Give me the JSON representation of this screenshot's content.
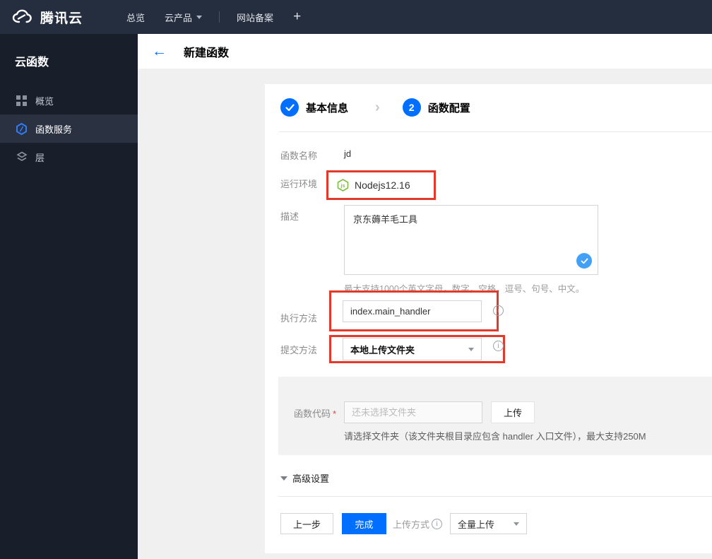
{
  "topbar": {
    "brand": "腾讯云",
    "nav": [
      {
        "label": "总览"
      },
      {
        "label": "云产品"
      },
      {
        "label": "网站备案"
      },
      {
        "label": "+"
      }
    ]
  },
  "sidebar": {
    "title": "云函数",
    "items": [
      {
        "label": "概览",
        "active": false
      },
      {
        "label": "函数服务",
        "active": true
      },
      {
        "label": "层",
        "active": false
      }
    ]
  },
  "header": {
    "title": "新建函数"
  },
  "steps": {
    "step1_label": "基本信息",
    "step2_number": "2",
    "step2_label": "函数配置"
  },
  "form": {
    "name_label": "函数名称",
    "name_value": "jd",
    "runtime_label": "运行环境",
    "runtime_value": "Nodejs12.16",
    "runtime_icon_text": "js",
    "desc_label": "描述",
    "desc_value": "京东薅羊毛工具",
    "desc_hint": "最大支持1000个英文字母，数字，空格，逗号、句号、中文。",
    "handler_label": "执行方法",
    "handler_value": "index.main_handler",
    "submit_label": "提交方法",
    "submit_value": "本地上传文件夹",
    "code_label": "函数代码",
    "code_required_mark": "*",
    "code_placeholder": "还未选择文件夹",
    "upload_button": "上传",
    "code_hint": "请选择文件夹（该文件夹根目录应包含 handler 入口文件），最大支持250M",
    "advanced_label": "高级设置"
  },
  "footer": {
    "prev_button": "上一步",
    "finish_button": "完成",
    "upload_mode_label": "上传方式",
    "upload_mode_value": "全量上传"
  },
  "colors": {
    "accent_blue": "#006eff",
    "light_check_blue": "#42a0f7",
    "annotation_red": "#e3392b",
    "node_green": "#7fbf3f",
    "topbar_bg": "#252e3e",
    "sidebar_bg": "#181f2b",
    "sidebar_active_bg": "#2a3140",
    "section_gray": "#f2f2f2"
  }
}
